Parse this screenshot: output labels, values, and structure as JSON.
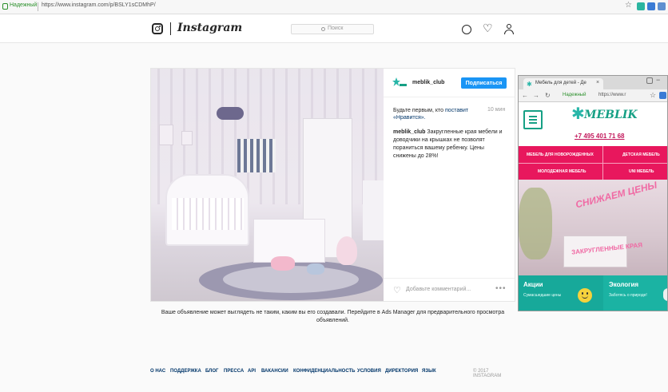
{
  "browser": {
    "secure_label": "Надежный",
    "url": "https://www.instagram.com/p/BSLY1sCDMhP/"
  },
  "header": {
    "wordmark": "Instagram",
    "search_placeholder": "Поиск"
  },
  "post": {
    "username": "meblik_club",
    "follow_label": "Подписаться",
    "first_like_prefix": "Будьте первым, кто",
    "first_like_link": "поставит «Нравится».",
    "time": "10 мин",
    "caption_user": "meblik_club",
    "caption_text": "Закругленные края мебели и доводчики на крышках не позволят пораниться вашему ребенку. Цены снижены до 28%!",
    "comment_placeholder": "Добавьте комментарий..."
  },
  "notice": "Ваше объявление может выглядеть не таким, каким вы его создавали. Перейдите в Ads Manager для предварительного просмотра объявлений.",
  "footer": {
    "links": [
      "О НАС",
      "ПОДДЕРЖКА",
      "БЛОГ",
      "ПРЕССА",
      "API",
      "ВАКАНСИИ",
      "КОНФИДЕНЦИАЛЬНОСТЬ",
      "УСЛОВИЯ",
      "ДИРЕКТОРИЯ",
      "ЯЗЫК"
    ],
    "copyright": "© 2017 INSTAGRAM"
  },
  "overlay": {
    "tab_title": "Мебель для детей - Де",
    "secure_label": "Надежный",
    "url": "https://www.r",
    "logo": "MEBLIK",
    "phone": "+7 495 401 71 68",
    "categories": [
      "МЕБЕЛЬ ДЛЯ НОВОРОЖДЕННЫХ",
      "ДЕТСКАЯ МЕБЕЛЬ",
      "МОЛОДЕЖНАЯ МЕБЕЛЬ",
      "UNI МЕБЕЛЬ"
    ],
    "banner_text1": "СНИЖАЕМ ЦЕНЫ",
    "banner_text2": "ЗАКРУГЛЕННЫЕ КРАЯ",
    "promo_title": "Акции",
    "promo_sub": "Сумасшедшие цены",
    "eco_title": "Экология",
    "eco_sub": "Заботясь о природе!"
  },
  "colors": {
    "instagram_blue": "#1a95f5",
    "meblik_pink": "#e8175d",
    "meblik_teal": "#17a99a"
  }
}
